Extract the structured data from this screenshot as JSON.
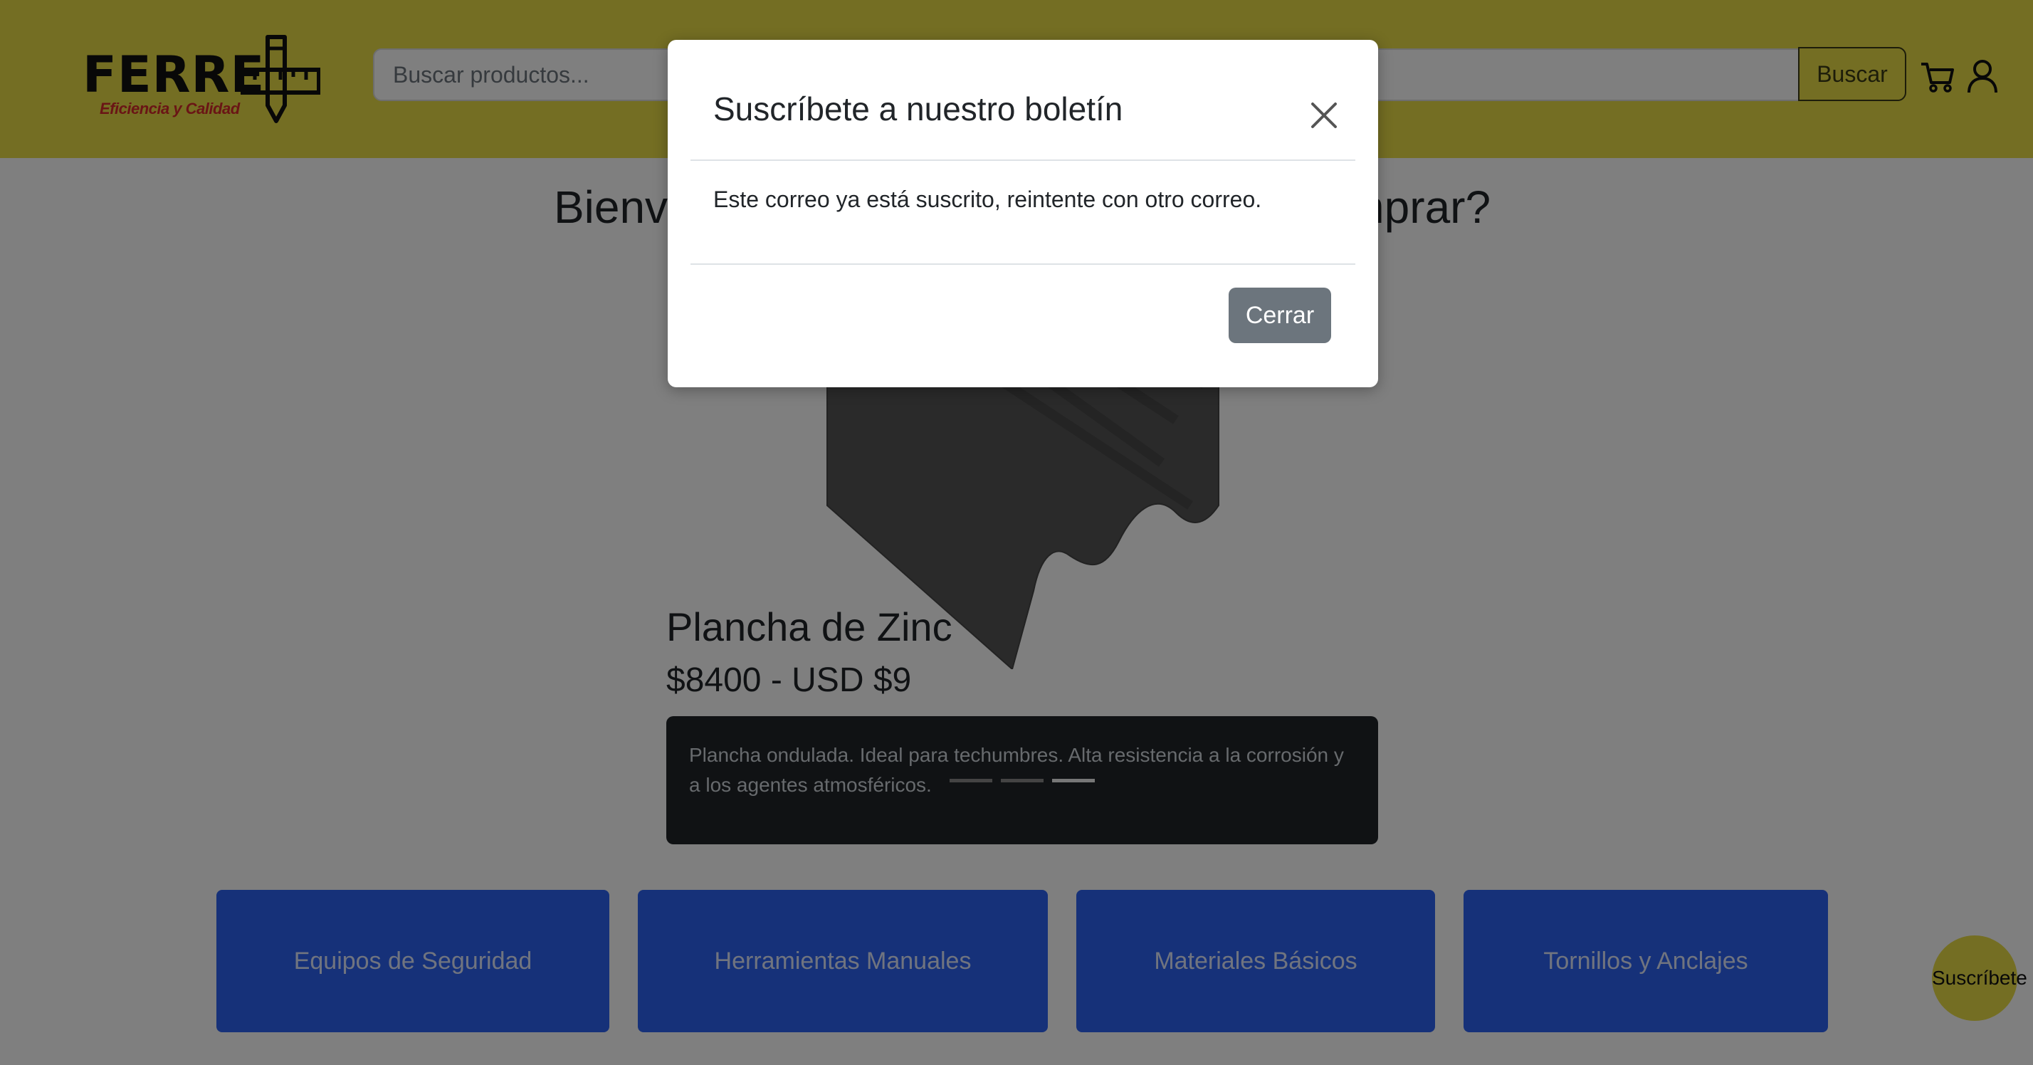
{
  "header": {
    "logo": {
      "brand": "FERRE",
      "tagline": "Eficiencia y Calidad"
    },
    "search": {
      "placeholder": "Buscar productos...",
      "button_label": "Buscar"
    },
    "icons": {
      "cart": "cart-icon",
      "user": "user-icon"
    },
    "background_color": "#e9dc47"
  },
  "main": {
    "welcome": "Bienvenido a Ferremas, ¿Qué vas a comprar?",
    "carousel": {
      "product_name": "Plancha de Zinc",
      "product_price": "$8400 - USD $9",
      "caption": "Plancha ondulada. Ideal para techumbres. Alta resistencia a la corrosión y a los agentes atmosféricos.",
      "indicators": 3,
      "active_indicator": 3
    },
    "categories": [
      {
        "label": "Equipos de Seguridad"
      },
      {
        "label": "Herramientas Manuales"
      },
      {
        "label": "Materiales Básicos"
      },
      {
        "label": "Tornillos y Anclajes"
      }
    ],
    "category_color": "#2d63f2",
    "subscribe_button": "Suscríbete"
  },
  "modal": {
    "title": "Suscríbete a nuestro boletín",
    "message": "Este correo ya está suscrito, reintente con otro correo.",
    "close_button": "Cerrar",
    "close_icon": "close-icon"
  }
}
